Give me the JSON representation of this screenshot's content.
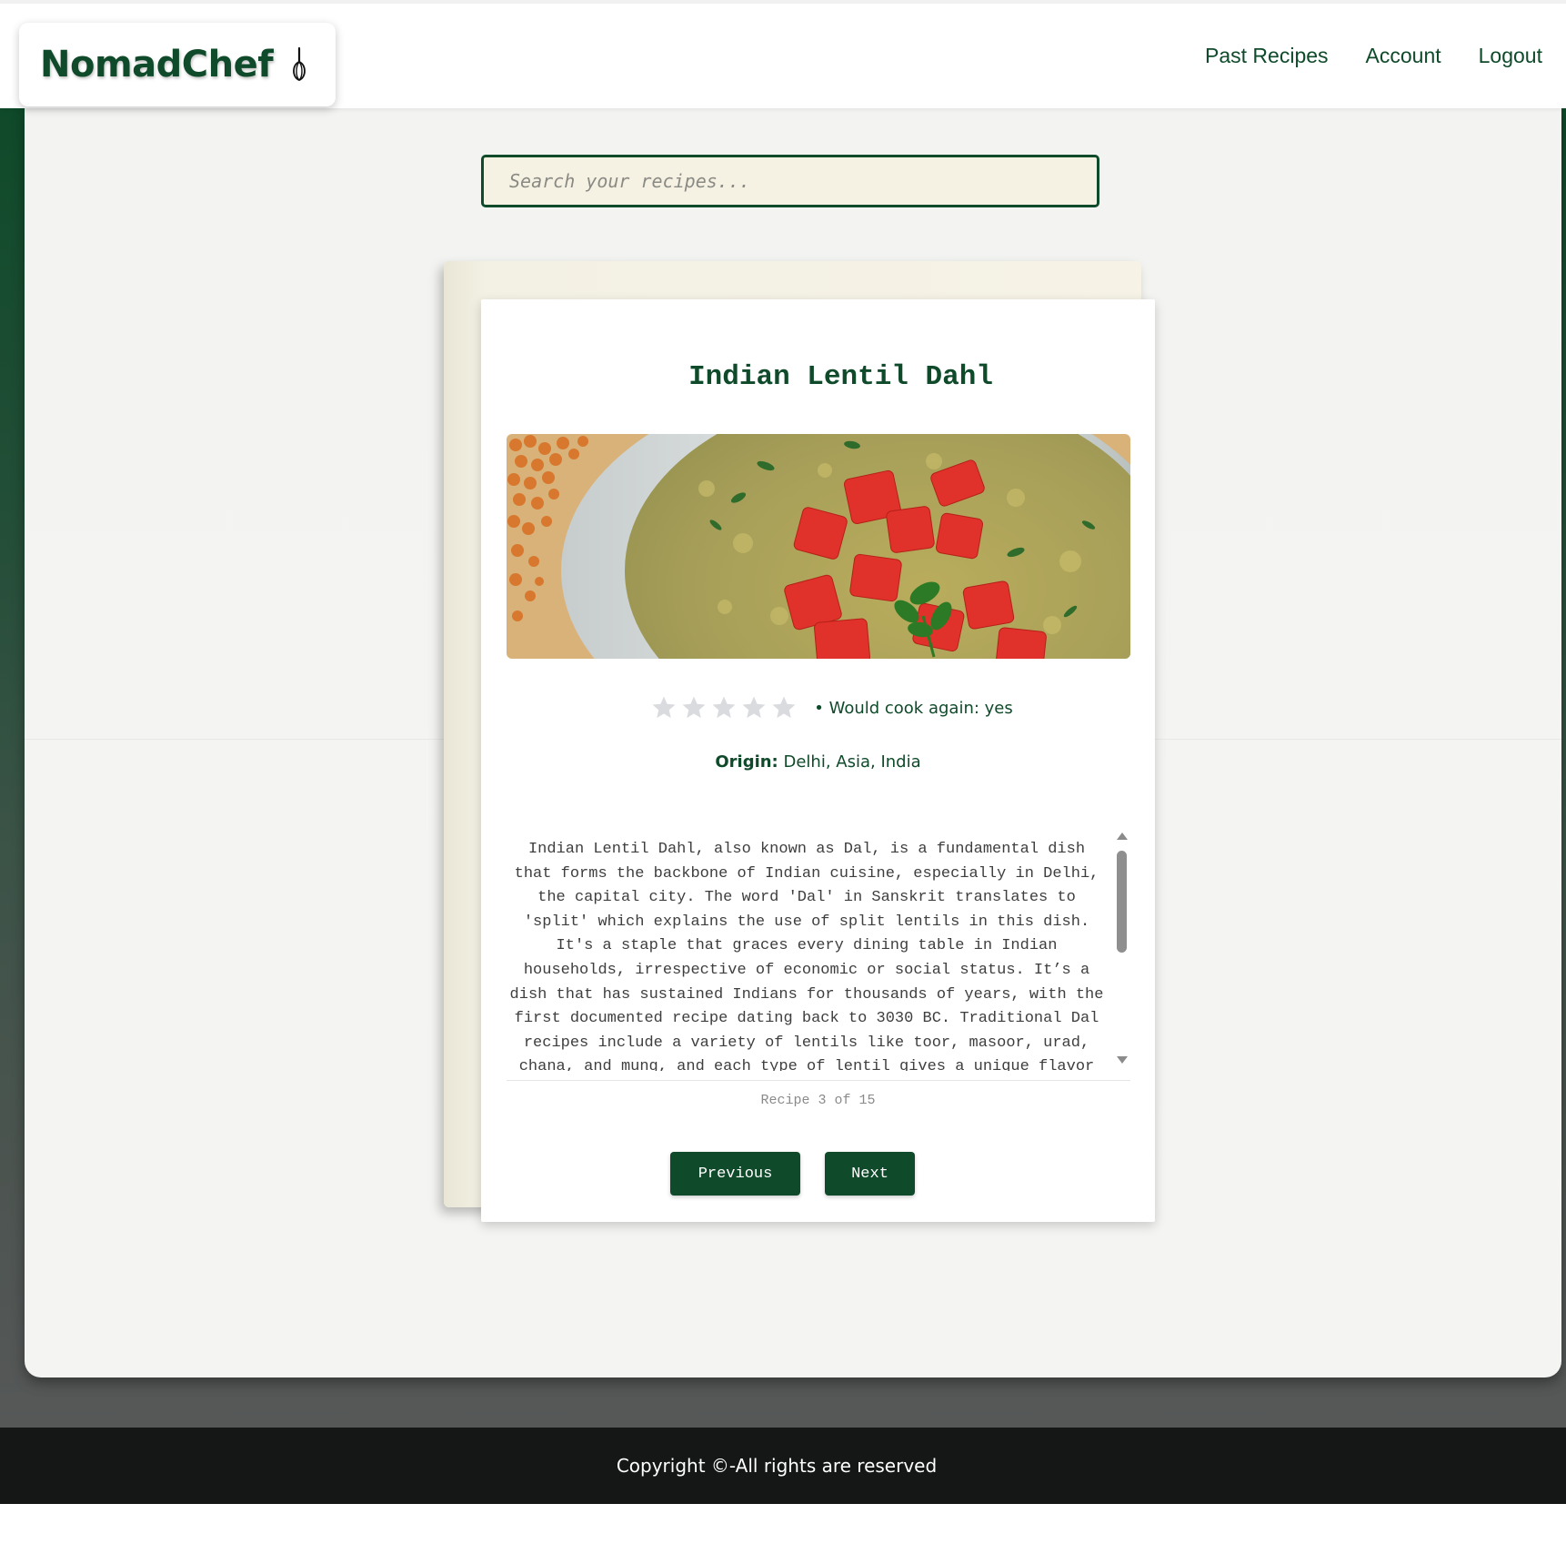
{
  "brand": {
    "name": "NomadChef",
    "icon": "whisk-icon",
    "color": "#0f4a2a"
  },
  "nav": {
    "items": [
      {
        "label": "Past Recipes",
        "icon": null
      },
      {
        "label": "Account",
        "icon": null
      },
      {
        "label": "Logout",
        "icon": null
      }
    ]
  },
  "search": {
    "placeholder": "Search your recipes...",
    "value": ""
  },
  "recipe": {
    "title": "Indian Lentil Dahl",
    "image_alt": "Indian Lentil Dahl",
    "rating": {
      "value": 0,
      "max": 5,
      "empty_star_color": "#d9dbdf"
    },
    "cook_again": "• Would cook again: yes",
    "origin_label": "Origin:",
    "origin_value": "Delhi, Asia, India",
    "description": "Indian Lentil Dahl, also known as Dal, is a fundamental dish that forms the backbone of Indian cuisine, especially in Delhi, the capital city. The word 'Dal' in Sanskrit translates to 'split' which explains the use of split lentils in this dish. It's a staple that graces every dining table in Indian households, irrespective of economic or social status. It’s a dish that has sustained Indians for thousands of years, with the first documented recipe dating back to 3030 BC. Traditional Dal recipes include a variety of lentils like toor, masoor, urad, chana, and mung, and each type of lentil gives a unique flavor to the dish. The lentils are first boiled until",
    "counter": "Recipe 3 of 15"
  },
  "pagination": {
    "previous_label": "Previous",
    "next_label": "Next"
  },
  "footer": {
    "text": "Copyright ©-All rights are reserved"
  },
  "colors": {
    "accent": "#0f4a2a",
    "search_bg": "#f6f2e3",
    "footer_bg": "#141716"
  }
}
